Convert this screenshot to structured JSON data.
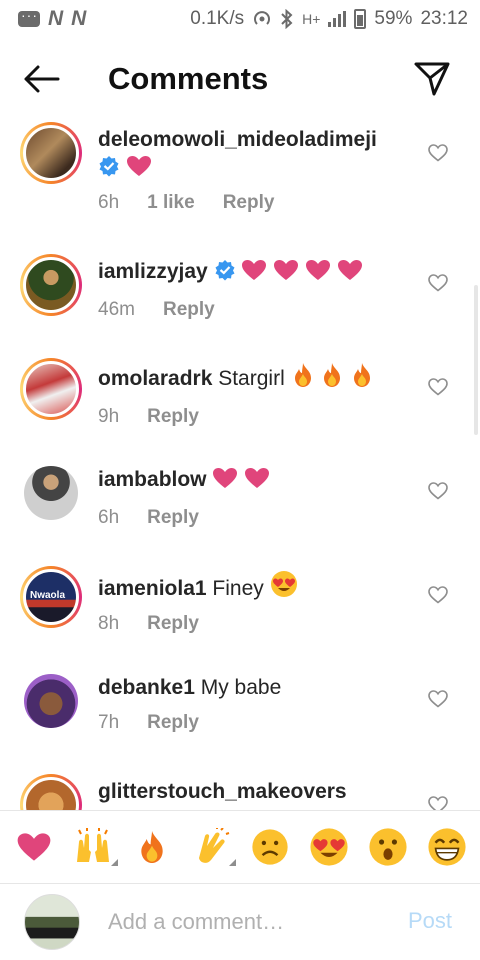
{
  "status_bar": {
    "speed": "0.1K/s",
    "network_label": "H+",
    "battery": "59%",
    "time": "23:12"
  },
  "header": {
    "title": "Comments"
  },
  "comments": [
    {
      "username": "deleomowoli_mideoladimeji",
      "text": "",
      "time": "6h",
      "likes": "1 like",
      "reply": "Reply",
      "verified": true,
      "emoji": [
        "pink-heart"
      ]
    },
    {
      "username": "iamlizzyjay",
      "text": "",
      "time": "46m",
      "reply": "Reply",
      "verified": true,
      "emoji": [
        "pink-heart",
        "pink-heart",
        "pink-heart",
        "pink-heart"
      ]
    },
    {
      "username": "omolaradrk",
      "text": "Stargirl",
      "time": "9h",
      "reply": "Reply",
      "verified": false,
      "emoji": [
        "fire",
        "fire",
        "fire"
      ]
    },
    {
      "username": "iambablow",
      "text": "",
      "time": "6h",
      "reply": "Reply",
      "verified": false,
      "emoji": [
        "pink-heart",
        "pink-heart"
      ]
    },
    {
      "username": "iameniola1",
      "text": "Finey",
      "time": "8h",
      "reply": "Reply",
      "verified": false,
      "emoji": [
        "heart-eyes"
      ]
    },
    {
      "username": "debanke1",
      "text": "My babe",
      "time": "7h",
      "reply": "Reply",
      "verified": false,
      "emoji": []
    },
    {
      "username": "glitterstouch_makeovers",
      "text": "",
      "time": "",
      "reply": "",
      "verified": false,
      "emoji": []
    }
  ],
  "avatar_overlay_text": "Nwaola",
  "emoji_bar": [
    "pink-heart",
    "raised-hands",
    "fire",
    "clapping-hands",
    "sad-face",
    "heart-eyes-face",
    "surprised-face",
    "grinning-face"
  ],
  "composer": {
    "placeholder": "Add a comment…",
    "post_label": "Post"
  },
  "colors": {
    "accent_blue": "#3897f0",
    "post_disabled": "#b6daf7",
    "heart_pink": "#e0457b",
    "verified_blue": "#3897f0"
  }
}
